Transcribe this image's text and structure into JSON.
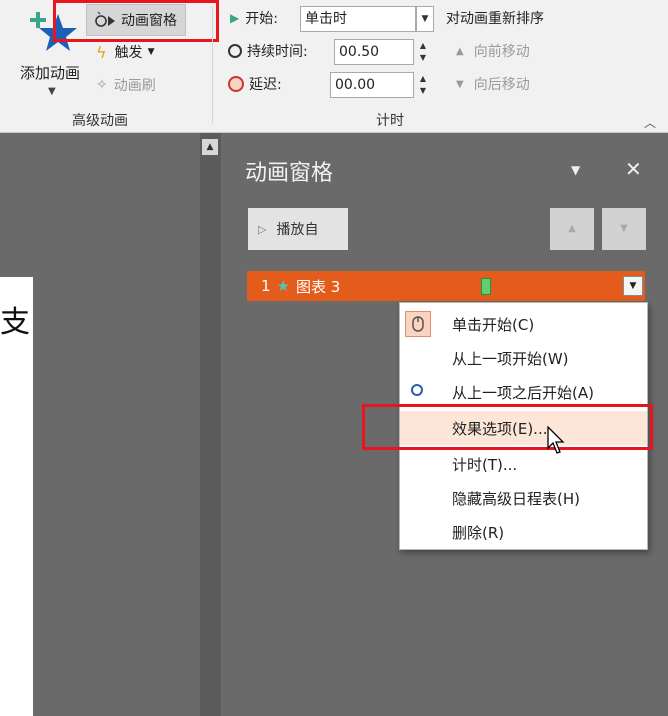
{
  "ribbon": {
    "add_animation": "添加动画",
    "animation_pane": "动画窗格",
    "trigger": "触发",
    "animation_painter": "动画刷",
    "advanced_group": "高级动画",
    "start_label": "开始:",
    "start_value": "单击时",
    "duration_label": "持续时间:",
    "duration_value": "00.50",
    "delay_label": "延迟:",
    "delay_value": "00.00",
    "timing_group": "计时",
    "reorder_title": "对动画重新排序",
    "move_earlier": "向前移动",
    "move_later": "向后移动"
  },
  "pane": {
    "title": "动画窗格",
    "play_from": "播放自",
    "item": {
      "number": "1",
      "name": "图表 3"
    }
  },
  "context_menu": {
    "items": [
      "单击开始(C)",
      "从上一项开始(W)",
      "从上一项之后开始(A)",
      "效果选项(E)...",
      "计时(T)...",
      "隐藏高级日程表(H)",
      "删除(R)"
    ],
    "hovered_index": 3
  },
  "colors": {
    "accent": "#e35c1c",
    "highlight": "#e8161c",
    "hover": "#fde5d7"
  }
}
